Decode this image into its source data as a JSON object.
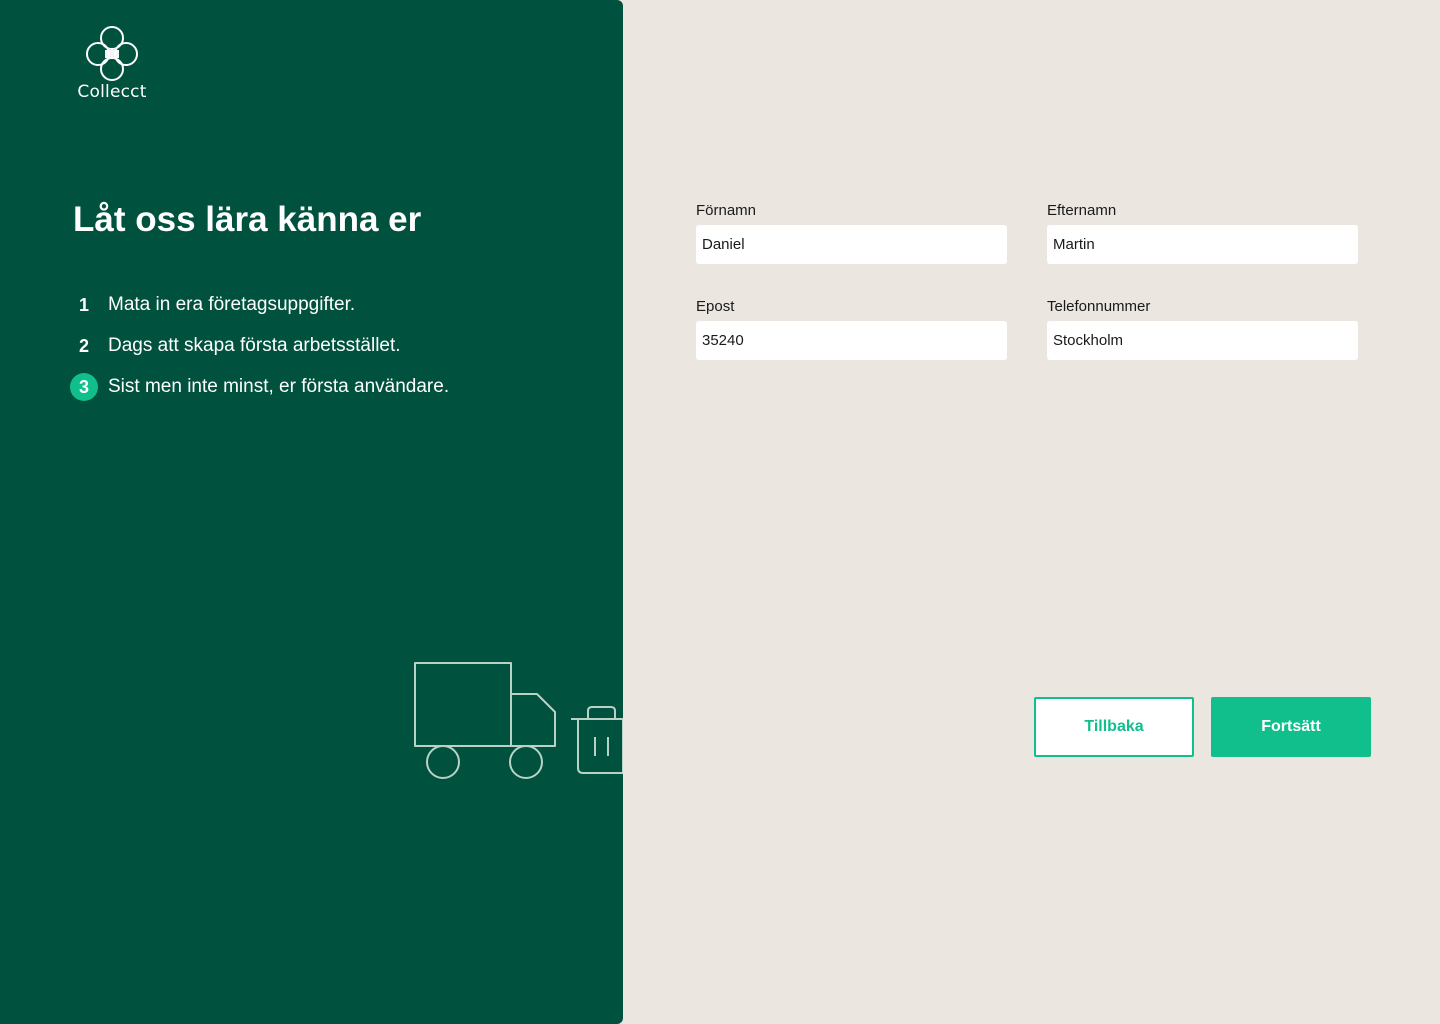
{
  "brand": {
    "name": "Collecct"
  },
  "intro": {
    "title": "Låt oss lära känna er",
    "steps": [
      {
        "number": "1",
        "text": "Mata in era företagsuppgifter.",
        "active": false
      },
      {
        "number": "2",
        "text": "Dags att skapa första arbetsstället.",
        "active": false
      },
      {
        "number": "3",
        "text": "Sist men inte minst, er första användare.",
        "active": true
      }
    ]
  },
  "form": {
    "first_name": {
      "label": "Förnamn",
      "value": "Daniel"
    },
    "last_name": {
      "label": "Efternamn",
      "value": "Martin"
    },
    "email": {
      "label": "Epost",
      "value": "35240"
    },
    "phone": {
      "label": "Telefonnummer",
      "value": "Stockholm"
    }
  },
  "actions": {
    "back_label": "Tillbaka",
    "continue_label": "Fortsätt"
  },
  "icons": {
    "logo": "collecct-logo-icon",
    "truck": "truck-icon",
    "trash": "trash-bin-icon"
  },
  "colors": {
    "panel": "#00513d",
    "accent": "#10bf8c",
    "background": "#ebe6e0",
    "input": "#ffffff"
  }
}
